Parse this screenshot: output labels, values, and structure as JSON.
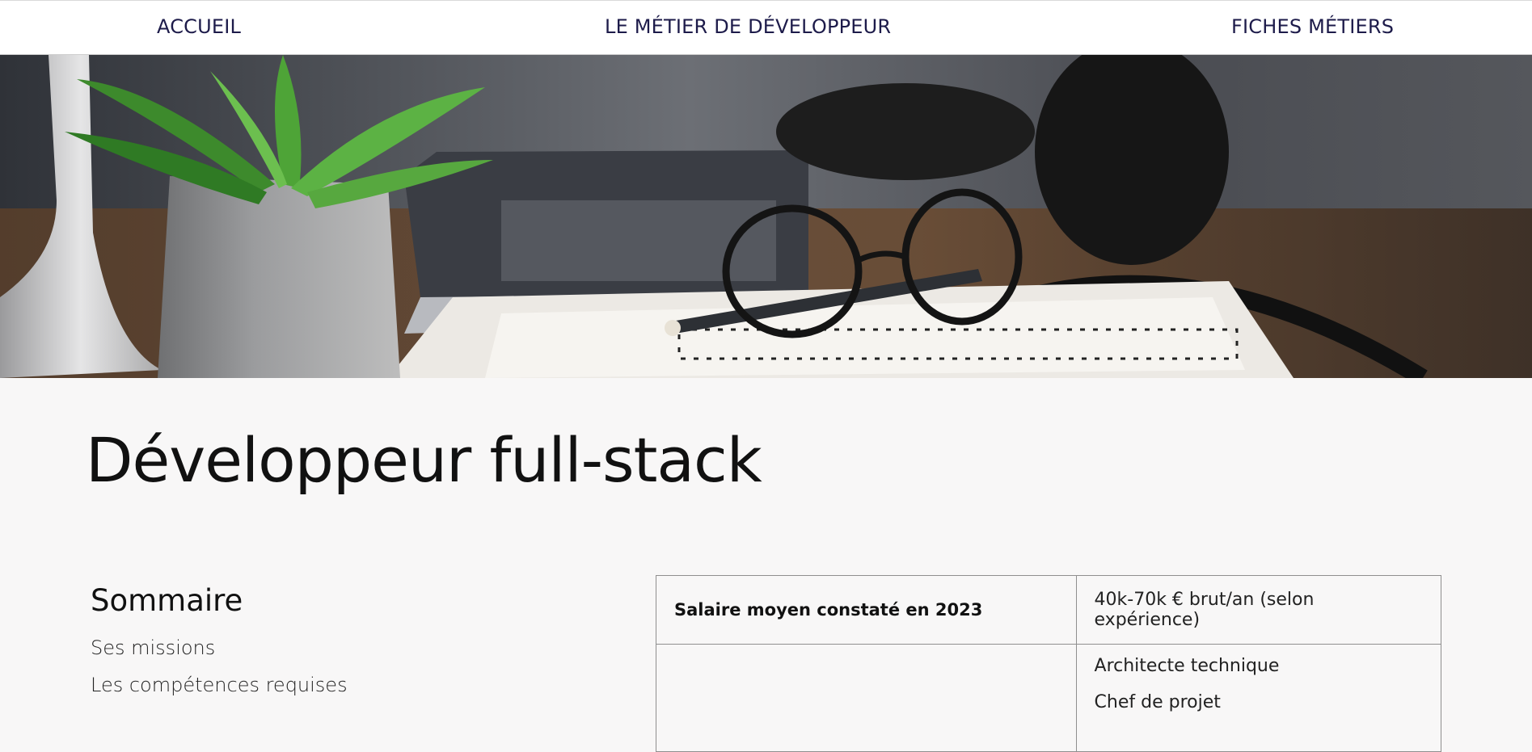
{
  "nav": {
    "items": [
      "ACCUEIL",
      "LE MÉTIER DE DÉVELOPPEUR",
      "FICHES MÉTIERS"
    ]
  },
  "hero": {
    "alt_subject": "desk-with-plant-laptop-glasses-notebook-headphones"
  },
  "page": {
    "title": "Développeur full-stack"
  },
  "toc": {
    "heading": "Sommaire",
    "items": [
      "Ses missions",
      "Les compétences requises"
    ]
  },
  "table": {
    "salary_label": "Salaire moyen constaté en 2023",
    "salary_value": "40k-70k € brut/an (selon expérience)",
    "careers": [
      "Architecte technique",
      "Chef de projet"
    ]
  },
  "colors": {
    "nav_text": "#1d1b4a",
    "background": "#f8f7f7",
    "table_border": "#8f8f8f"
  }
}
